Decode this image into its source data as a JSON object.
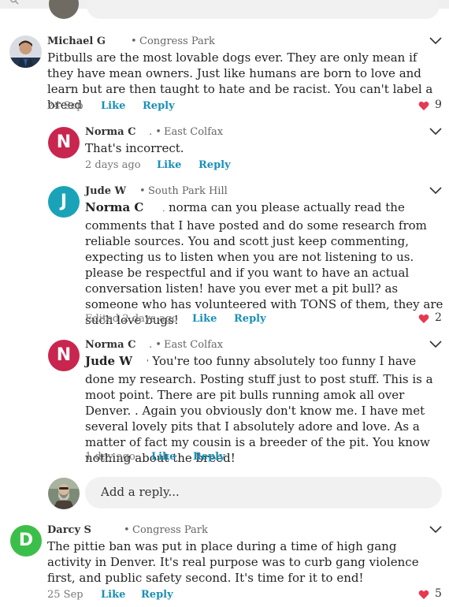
{
  "colors": {
    "accent": "#1a8fb8",
    "heart": "#e63950",
    "norma_avatar": "#c8264f",
    "jude_avatar": "#1aa3b8",
    "darcy_avatar": "#3cbf4a"
  },
  "comments": [
    {
      "author": "Michael G",
      "separator": "•",
      "neighborhood": "Congress Park",
      "text": "Pitbulls are the most lovable dogs ever. They are only mean if they have mean owners. Just like humans are born to love and learn but are then taught to hate and be racist. You can't label a breed",
      "time": "24 Sep",
      "like_label": "Like",
      "reply_label": "Reply",
      "likes": "9",
      "replies": [
        {
          "author": "Norma C",
          "initial": "N",
          "separator": ". •",
          "neighborhood": "East Colfax",
          "text": "That's incorrect.",
          "time": "2 days ago",
          "like_label": "Like",
          "reply_label": "Reply"
        },
        {
          "author": "Jude W",
          "initial": "J",
          "separator": "•",
          "neighborhood": "South Park Hill",
          "mention": "Norma C",
          "mention_suffix": ".",
          "text": " norma can you please actually read the comments that I have posted and do some research from reliable sources. You and scott just keep commenting, expecting us to listen when you are not listening to us. please be respectful and if you want to have an actual conversation listen! have you ever met a pit bull? as someone who has volunteered with TONS of them, they are such love bugs!",
          "time": "Edited 2 days ago",
          "like_label": "Like",
          "reply_label": "Reply",
          "likes": "2"
        },
        {
          "author": "Norma C",
          "initial": "N",
          "separator": ". •",
          "neighborhood": "East Colfax",
          "mention": "Jude W",
          "mention_suffix": "'",
          "text": " You're too funny absolutely too funny I have done my research. Posting stuff just to post stuff. This is a moot point. There are pit bulls running amok all over Denver. . Again you obviously don't know me. I have met several lovely pits that I absolutely adore and love. As a matter of fact my cousin is a breeder of the pit.   You know nothing about the breed!",
          "time": "1 day ago",
          "like_label": "Like",
          "reply_label": "Reply"
        }
      ],
      "reply_placeholder": "Add a reply..."
    },
    {
      "author": "Darcy S",
      "initial": "D",
      "separator": "•",
      "neighborhood": "Congress Park",
      "text": "The pittie ban was put in place during a time of high gang activity in Denver. It's real purpose was to curb gang violence first, and public safety second. It's time for it to end!",
      "time": "25 Sep",
      "like_label": "Like",
      "reply_label": "Reply",
      "likes": "5"
    }
  ]
}
